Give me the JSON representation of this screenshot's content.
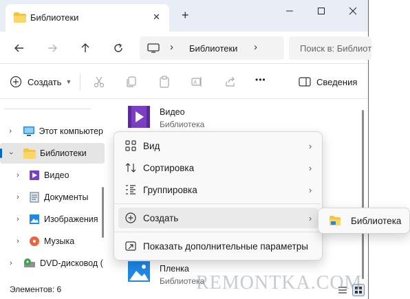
{
  "tab": {
    "title": "Библиотеки",
    "close_symbol": "✕",
    "new_tab_symbol": "+"
  },
  "window_controls": {
    "minimize": "—",
    "maximize": "☐",
    "close": "✕"
  },
  "address": {
    "breadcrumb": "Библиотеки",
    "separator": "›",
    "search_placeholder": "Поиск в: Библиотеки"
  },
  "toolbar": {
    "create_label": "Создать",
    "more_label": "•••",
    "details_label": "Сведения"
  },
  "sidebar": {
    "items": [
      {
        "label": "Этот компьютер",
        "icon": "monitor-icon",
        "level": 0,
        "expanded": false,
        "selected": false
      },
      {
        "label": "Библиотеки",
        "icon": "folder-icon",
        "level": 0,
        "expanded": true,
        "selected": true
      },
      {
        "label": "Видео",
        "icon": "video-library-icon",
        "level": 1,
        "expanded": false,
        "selected": false
      },
      {
        "label": "Документы",
        "icon": "documents-icon",
        "level": 1,
        "expanded": false,
        "selected": false
      },
      {
        "label": "Изображения",
        "icon": "pictures-icon",
        "level": 1,
        "expanded": false,
        "selected": false
      },
      {
        "label": "Музыка",
        "icon": "music-icon",
        "level": 1,
        "expanded": false,
        "selected": false
      },
      {
        "label": "DVD-дисковод (",
        "icon": "dvd-drive-icon",
        "level": 0,
        "expanded": false,
        "selected": false
      }
    ]
  },
  "content": {
    "items": [
      {
        "name": "Видео",
        "type": "Библиотека",
        "icon": "video-library-icon"
      },
      {
        "name": "Пленка",
        "type": "Библиотека",
        "icon": "camera-roll-icon"
      }
    ]
  },
  "context_menu": {
    "items": [
      {
        "label": "Вид",
        "icon": "grid-view-icon",
        "has_submenu": true,
        "highlighted": false
      },
      {
        "label": "Сортировка",
        "icon": "sort-icon",
        "has_submenu": true,
        "highlighted": false
      },
      {
        "label": "Группировка",
        "icon": "group-icon",
        "has_submenu": true,
        "highlighted": false
      },
      {
        "label": "Создать",
        "icon": "new-icon",
        "has_submenu": true,
        "highlighted": true
      },
      {
        "label": "Показать дополнительные параметры",
        "icon": "more-options-icon",
        "has_submenu": false,
        "highlighted": false
      }
    ],
    "arrow": "›"
  },
  "submenu": {
    "items": [
      {
        "label": "Библиотека",
        "icon": "library-folder-icon"
      }
    ]
  },
  "status": {
    "count": "Элементов: 6"
  },
  "watermark": "REMONTKA.COM",
  "colors": {
    "accent": "#0067c0",
    "tabbar_bg": "#e9eef6",
    "folder": "#f3c343",
    "video": "#7b3fc4",
    "pictures": "#1f88e5",
    "selection": "#e5e5e5"
  }
}
